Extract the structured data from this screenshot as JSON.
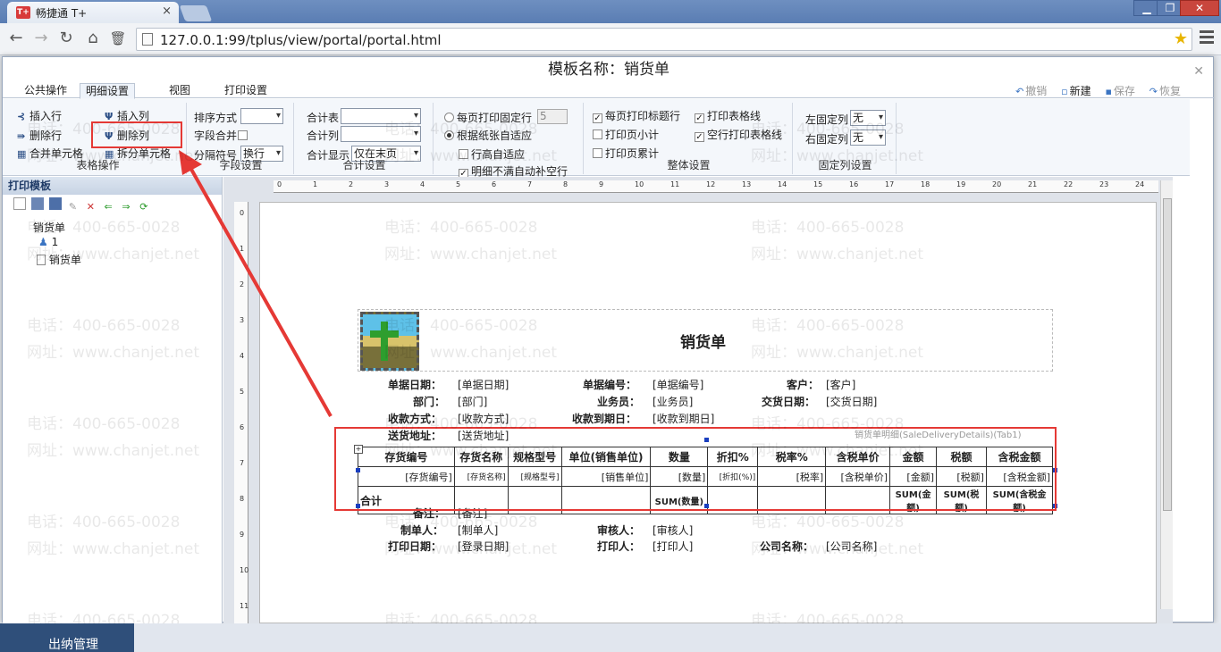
{
  "browser": {
    "tab_title": "畅捷通 T+",
    "tab_icon": "T+",
    "url": "127.0.0.1:99/tplus/view/portal/portal.html"
  },
  "dialog": {
    "title": "模板名称：销货单",
    "tabs": [
      "公共操作",
      "明细设置",
      "视图",
      "打印设置"
    ],
    "actions": {
      "undo": "撤销",
      "new": "新建",
      "save": "保存",
      "restore": "恢复"
    }
  },
  "ribbon": {
    "table_ops": {
      "label": "表格操作",
      "insert_row": "插入行",
      "insert_col": "插入列",
      "delete_row": "删除行",
      "delete_col": "删除列",
      "merge_cells": "合并单元格",
      "split_cells": "拆分单元格"
    },
    "field_settings": {
      "label": "字段设置",
      "sort": "排序方式",
      "merge": "字段合并",
      "separator": "分隔符号",
      "separator_value": "换行"
    },
    "total_settings": {
      "label": "合计设置",
      "total_table": "合计表",
      "total_col": "合计列",
      "total_display": "合计显示",
      "total_display_value": "仅在末页"
    },
    "page_settings": {
      "fixed_rows": "每页打印固定行",
      "fixed_rows_value": "5",
      "auto_fit": "根据纸张自适应",
      "row_height_auto": "行高自适应",
      "fill_blank": "明细不满自动补空行"
    },
    "overall": {
      "label": "整体设置",
      "print_title_each": "每页打印标题行",
      "print_subtotal": "打印页小计",
      "print_cumulative": "打印页累计",
      "print_grid": "打印表格线",
      "blank_grid": "空行打印表格线"
    },
    "fixed_cols": {
      "label": "固定列设置",
      "left": "左固定列",
      "left_value": "无",
      "right": "右固定列",
      "right_value": "无"
    }
  },
  "left_panel": {
    "title": "打印模板",
    "tree_root": "销货单",
    "tree_user": "1",
    "tree_doc": "销货单"
  },
  "ruler": {
    "h_ticks": [
      "0",
      "1",
      "2",
      "3",
      "4",
      "5",
      "6",
      "7",
      "8",
      "9",
      "10",
      "11",
      "12",
      "13",
      "14",
      "15",
      "16",
      "17",
      "18",
      "19",
      "20",
      "21",
      "22",
      "23",
      "24"
    ],
    "v_ticks": [
      "0",
      "1",
      "2",
      "3",
      "4",
      "5",
      "6",
      "7",
      "8",
      "9",
      "10",
      "11"
    ]
  },
  "report": {
    "title": "销货单",
    "header_fields": [
      {
        "label": "单据日期：",
        "value": "[单据日期]"
      },
      {
        "label": "单据编号：",
        "value": "[单据编号]"
      },
      {
        "label": "客户：",
        "value": "[客户]"
      },
      {
        "label": "部门：",
        "value": "[部门]"
      },
      {
        "label": "业务员：",
        "value": "[业务员]"
      },
      {
        "label": "交货日期：",
        "value": "[交货日期]"
      },
      {
        "label": "收款方式：",
        "value": "[收款方式]"
      },
      {
        "label": "收款到期日：",
        "value": "[收款到期日]"
      },
      {
        "label": "送货地址：",
        "value": "[送货地址]"
      }
    ],
    "detail_caption": "销货单明细(SaleDeliveryDetails)(Tab1)",
    "detail_headers": [
      "存货编号",
      "存货名称",
      "规格型号",
      "单位(销售单位)",
      "数量",
      "折扣%",
      "税率%",
      "含税单价",
      "金额",
      "税额",
      "含税金额"
    ],
    "detail_values": [
      "[存货编号]",
      "[存货名称]",
      "[规格型号]",
      "[销售单位]",
      "[数量]",
      "[折扣(%)]",
      "[税率]",
      "[含税单价]",
      "[金额]",
      "[税额]",
      "[含税金额]"
    ],
    "total_label": "合计",
    "total_values": [
      "",
      "",
      "",
      "SUM(数量)",
      "",
      "",
      "",
      "SUM(金额)",
      "SUM(税额)",
      "SUM(含税金额)"
    ],
    "footer_fields": [
      {
        "label": "备注：",
        "value": "[备注]"
      },
      {
        "label": "制单人：",
        "value": "[制单人]"
      },
      {
        "label": "审核人：",
        "value": "[审核人]"
      },
      {
        "label": "打印日期：",
        "value": "[登录日期]"
      },
      {
        "label": "打印人：",
        "value": "[打印人]"
      },
      {
        "label": "公司名称：",
        "value": "[公司名称]"
      }
    ]
  },
  "watermark": {
    "phone": "电话：400-665-0028",
    "site": "网址：www.chanjet.net"
  },
  "bottom": {
    "button": "出纳管理"
  },
  "colors": {
    "highlight": "#e53935",
    "anchor": "#1a3fbf"
  }
}
